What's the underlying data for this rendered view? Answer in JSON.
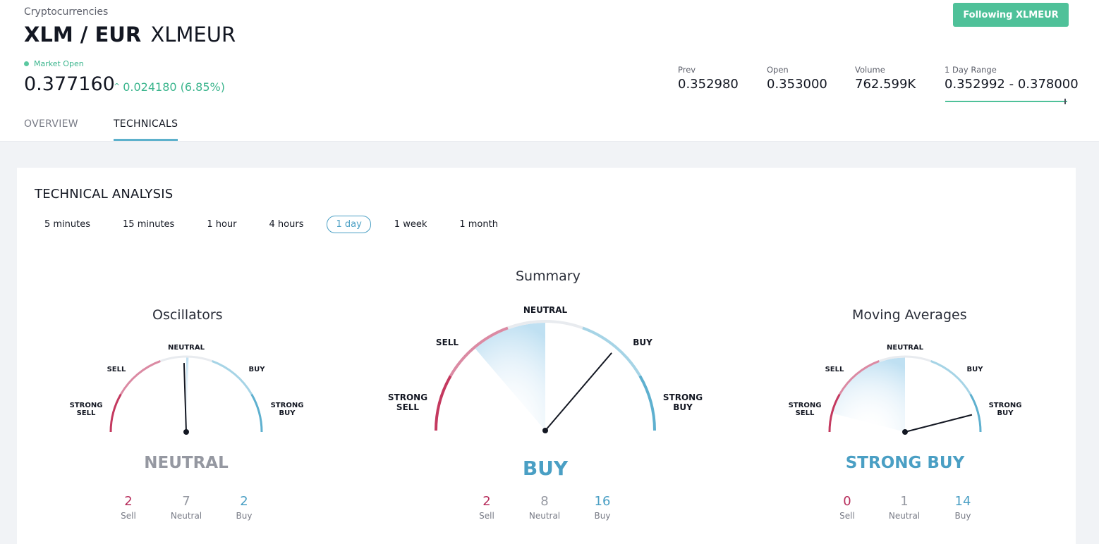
{
  "header": {
    "category": "Cryptocurrencies",
    "pair": "XLM / EUR",
    "symbol": "XLMEUR",
    "follow_label": "Following XLMEUR",
    "market_status": "Market Open",
    "price": "0.377160",
    "change": "0.024180 (6.85%)",
    "stats": {
      "prev": {
        "label": "Prev",
        "value": "0.352980"
      },
      "open": {
        "label": "Open",
        "value": "0.353000"
      },
      "volume": {
        "label": "Volume",
        "value": "762.599K"
      },
      "range": {
        "label": "1 Day Range",
        "value": "0.352992 - 0.378000",
        "position_fraction": 0.98
      }
    },
    "tabs": [
      {
        "label": "OVERVIEW",
        "active": false
      },
      {
        "label": "TECHNICALS",
        "active": true
      }
    ]
  },
  "technical": {
    "title": "TECHNICAL ANALYSIS",
    "intervals": [
      {
        "label": "5 minutes",
        "active": false
      },
      {
        "label": "15 minutes",
        "active": false
      },
      {
        "label": "1 hour",
        "active": false
      },
      {
        "label": "4 hours",
        "active": false
      },
      {
        "label": "1 day",
        "active": true
      },
      {
        "label": "1 week",
        "active": false
      },
      {
        "label": "1 month",
        "active": false
      }
    ],
    "scale_labels": {
      "strong_sell": "STRONG\nSELL",
      "sell": "SELL",
      "neutral": "NEUTRAL",
      "buy": "BUY",
      "strong_buy": "STRONG\nBUY"
    },
    "count_labels": {
      "sell": "Sell",
      "neutral": "Neutral",
      "buy": "Buy"
    },
    "gauges": {
      "oscillators": {
        "title": "Oscillators",
        "verdict": "NEUTRAL",
        "sell": "2",
        "neutral": "7",
        "buy": "2",
        "needle_score": -0.02
      },
      "summary": {
        "title": "Summary",
        "verdict": "BUY",
        "sell": "2",
        "neutral": "8",
        "buy": "16",
        "needle_score": 0.45
      },
      "moving_averages": {
        "title": "Moving Averages",
        "verdict": "STRONG BUY",
        "sell": "0",
        "neutral": "1",
        "buy": "14",
        "needle_score": 0.84
      }
    }
  },
  "colors": {
    "accent": "#4fc199",
    "sell": "#b72e5c",
    "neutral": "#9598a1",
    "buy": "#4a9fc4",
    "tab_underline": "#5db1cc"
  }
}
